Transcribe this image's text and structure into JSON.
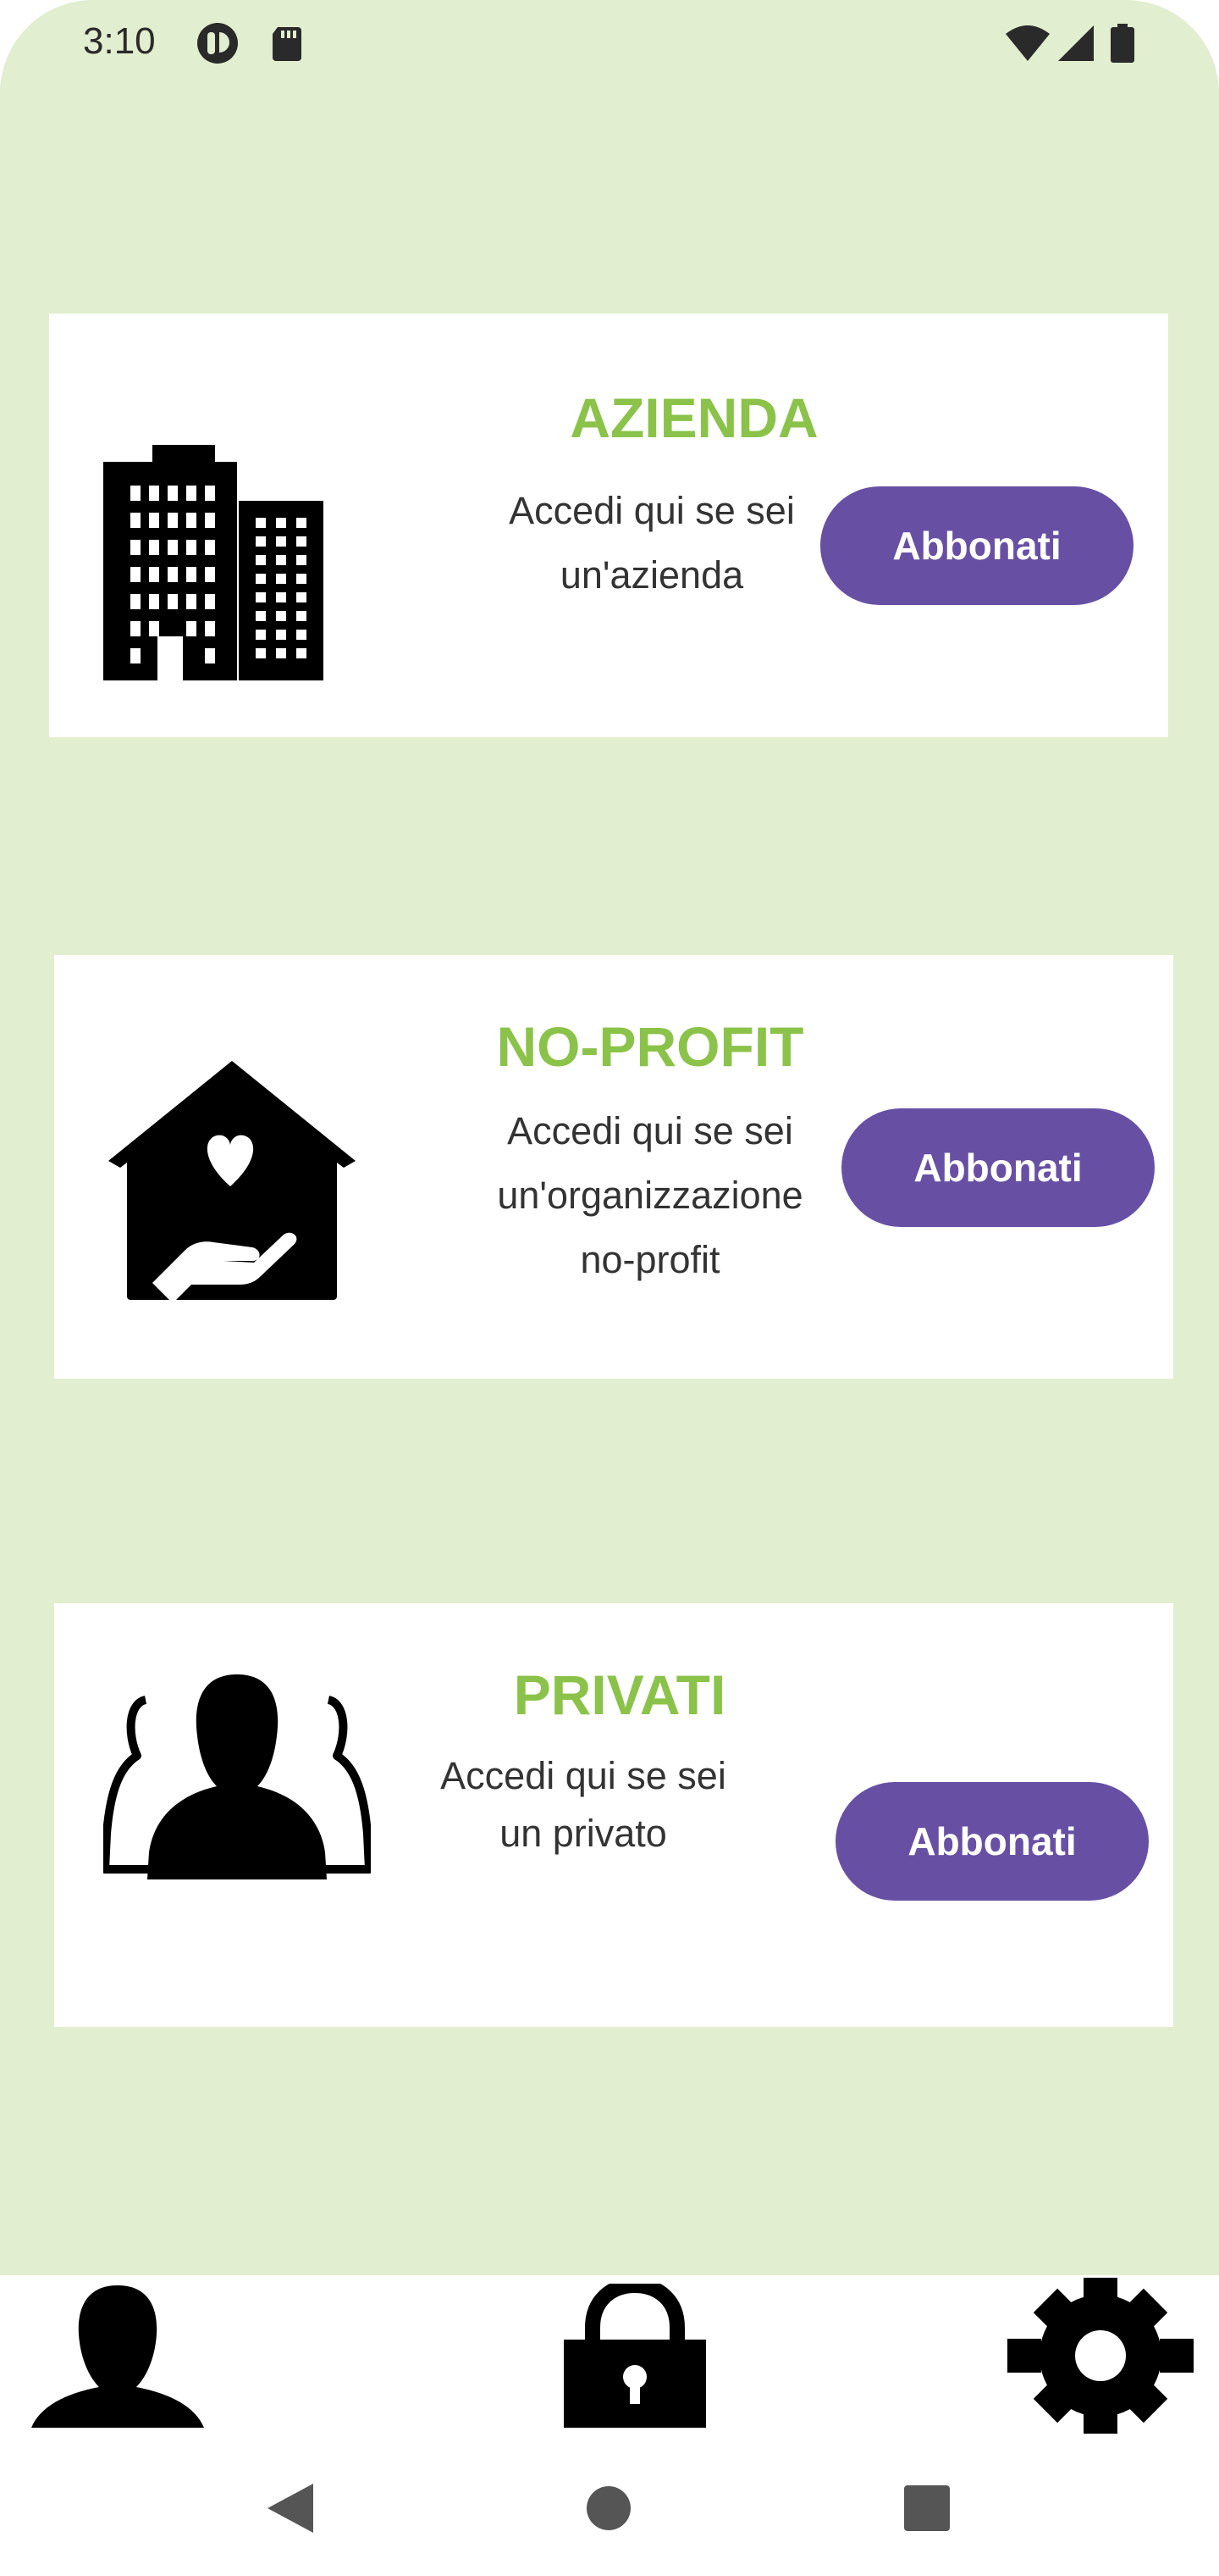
{
  "status_bar": {
    "time": "3:10",
    "icons_left": [
      "app-notification-icon",
      "sd-card-icon"
    ],
    "icons_right": [
      "wifi-icon",
      "cellular-signal-icon",
      "battery-icon"
    ]
  },
  "cards": [
    {
      "id": "azienda",
      "icon": "office-building-icon",
      "title": "AZIENDA",
      "description": "Accedi qui se sei\nun'azienda",
      "button_label": "Abbonati"
    },
    {
      "id": "no-profit",
      "icon": "house-heart-hand-icon",
      "title": "NO-PROFIT",
      "description": "Accedi qui se sei\nun'organizzazione\nno-profit",
      "button_label": "Abbonati"
    },
    {
      "id": "privati",
      "icon": "people-group-icon",
      "title": "PRIVATI",
      "description": "Accedi qui se sei\nun privato",
      "button_label": "Abbonati"
    }
  ],
  "bottom_nav": {
    "items": [
      {
        "icon": "user-icon"
      },
      {
        "icon": "lock-icon"
      },
      {
        "icon": "gear-icon"
      }
    ]
  },
  "system_nav": {
    "items": [
      "back-icon",
      "home-icon",
      "recents-icon"
    ]
  },
  "colors": {
    "background": "#e1eecf",
    "card": "#ffffff",
    "title": "#8bc34a",
    "button": "#6750a4",
    "button_text": "#ffffff"
  }
}
